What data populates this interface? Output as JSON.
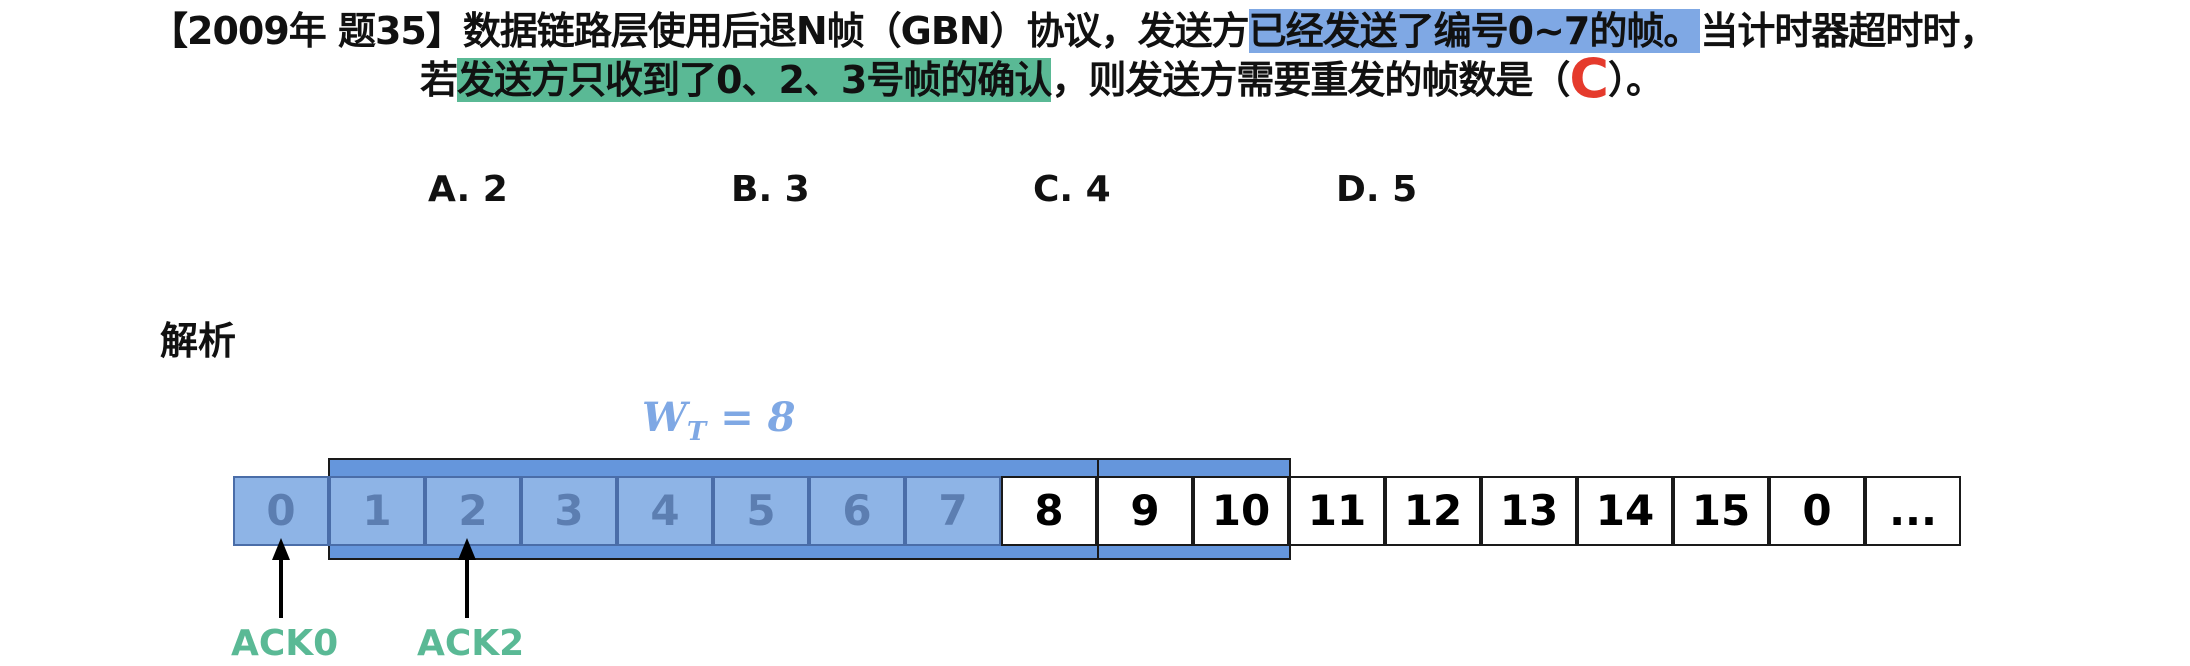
{
  "question": {
    "line1": {
      "prefix": "【2009年 题35】数据链路层使用后退N帧（GBN）协议，发送方",
      "highlight_blue": "已经发送了编号0~7的帧。",
      "suffix": "当计时器超时时，"
    },
    "line2": {
      "prefix": "若",
      "highlight_green": "发送方只收到了0、2、3号帧的确认",
      "suffix": "，则发送方需要重发的帧数是（",
      "answer": "C",
      "end": "）。"
    }
  },
  "options": [
    "A. 2",
    "B. 3",
    "C. 4",
    "D. 5"
  ],
  "analysis": {
    "heading": "解析",
    "window_label_main": "W",
    "window_label_sub": "T",
    "window_label_value": " = 8",
    "frames": [
      {
        "label": "0",
        "state": "sent"
      },
      {
        "label": "1",
        "state": "sent"
      },
      {
        "label": "2",
        "state": "sent"
      },
      {
        "label": "3",
        "state": "sent"
      },
      {
        "label": "4",
        "state": "sent"
      },
      {
        "label": "5",
        "state": "sent"
      },
      {
        "label": "6",
        "state": "sent"
      },
      {
        "label": "7",
        "state": "sent"
      },
      {
        "label": "8",
        "state": "unsent"
      },
      {
        "label": "9",
        "state": "unsent"
      },
      {
        "label": "10",
        "state": "unsent"
      },
      {
        "label": "11",
        "state": "unsent"
      },
      {
        "label": "12",
        "state": "unsent"
      },
      {
        "label": "13",
        "state": "unsent"
      },
      {
        "label": "14",
        "state": "unsent"
      },
      {
        "label": "15",
        "state": "unsent"
      },
      {
        "label": "0",
        "state": "unsent"
      },
      {
        "label": "...",
        "state": "unsent"
      }
    ],
    "acks": [
      "ACK0",
      "ACK2"
    ]
  },
  "colors": {
    "highlight_blue": "#7fa8e4",
    "highlight_green": "#5ab995",
    "answer_red": "#e53a2c",
    "window_band": "#6596dc",
    "sent_frame": "#8eb4e6"
  }
}
